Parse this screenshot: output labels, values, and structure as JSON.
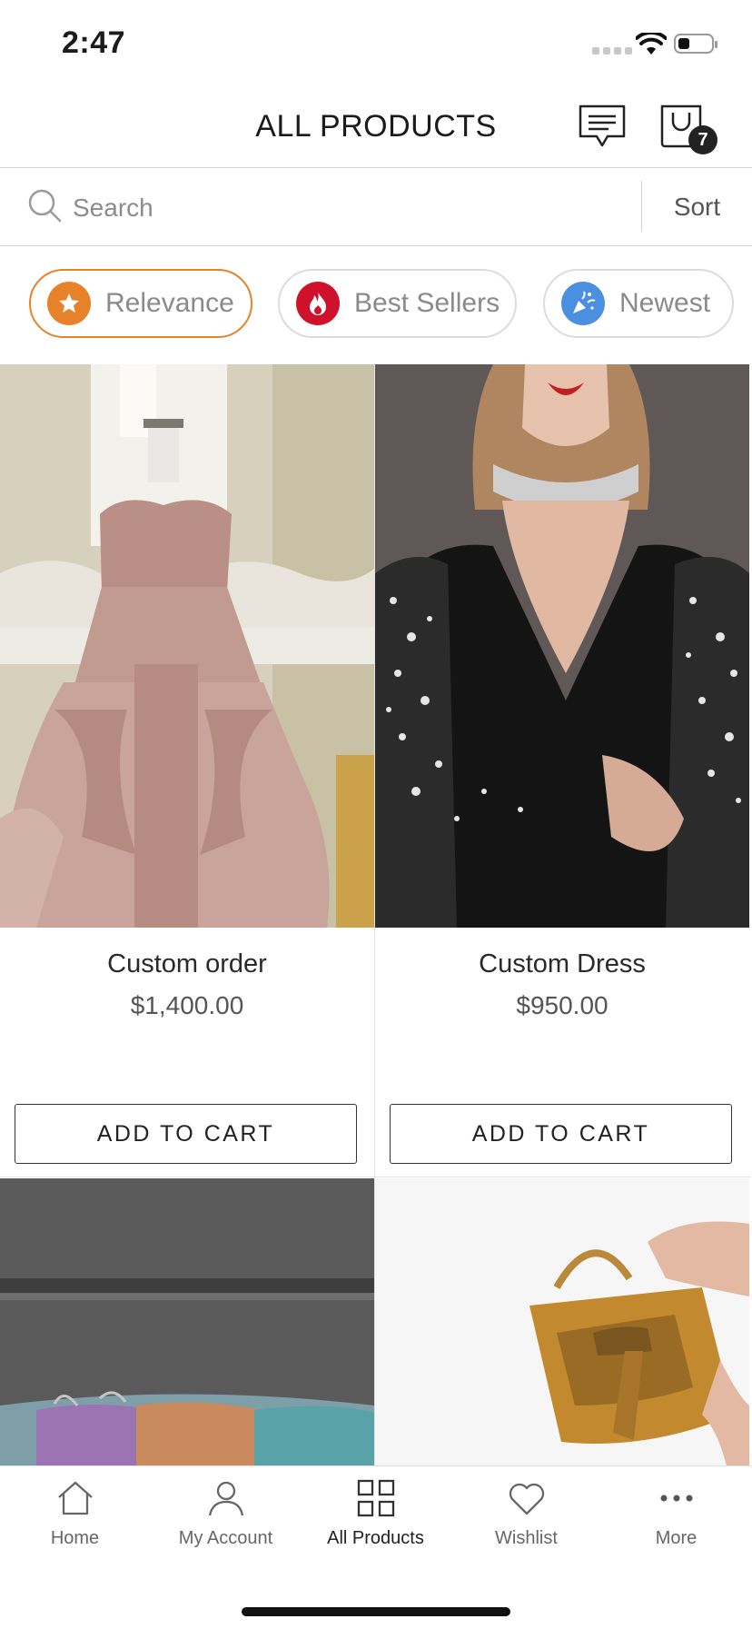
{
  "status_bar": {
    "time": "2:47"
  },
  "header": {
    "title": "ALL PRODUCTS",
    "cart_count": "7"
  },
  "search": {
    "placeholder": "Search",
    "sort_label": "Sort"
  },
  "filters": [
    {
      "label": "Relevance",
      "icon": "star-icon",
      "color": "#E8822A",
      "active": true
    },
    {
      "label": "Best Sellers",
      "icon": "flame-icon",
      "color": "#D0112B",
      "active": false
    },
    {
      "label": "Newest",
      "icon": "party-icon",
      "color": "#4A8FE0",
      "active": false
    }
  ],
  "products": [
    {
      "name": "Custom order",
      "price": "$1,400.00",
      "button": "ADD TO CART",
      "image": "pink-ball-gown-photo"
    },
    {
      "name": "Custom Dress",
      "price": "$950.00",
      "button": "ADD TO CART",
      "image": "black-embellished-dress-photo"
    },
    {
      "name": "",
      "price": "",
      "button": "",
      "image": "iridescent-python-bag-photo"
    },
    {
      "name": "",
      "price": "",
      "button": "",
      "image": "gold-python-handbag-photo"
    }
  ],
  "tabbar": [
    {
      "label": "Home",
      "icon": "home-icon",
      "active": false
    },
    {
      "label": "My Account",
      "icon": "user-icon",
      "active": false
    },
    {
      "label": "All Products",
      "icon": "grid-icon",
      "active": true
    },
    {
      "label": "Wishlist",
      "icon": "heart-icon",
      "active": false
    },
    {
      "label": "More",
      "icon": "more-dots-icon",
      "active": false
    }
  ],
  "colors": {
    "accent": "#E8822A",
    "text": "#1B1B1B",
    "muted": "#8A8A8A",
    "border": "#D8D8D8"
  }
}
